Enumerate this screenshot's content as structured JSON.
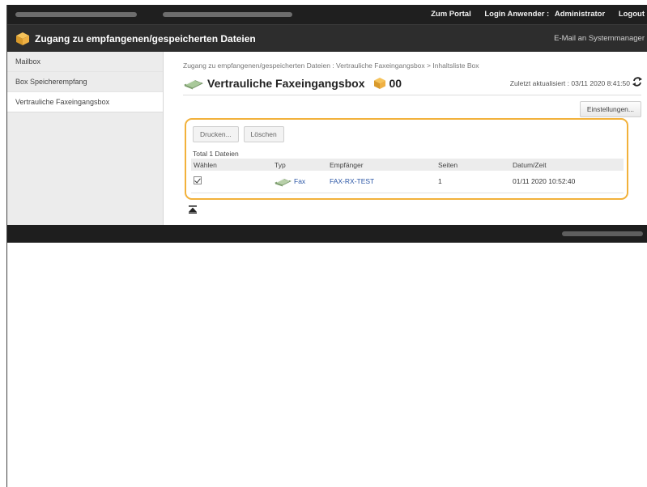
{
  "topbar": {
    "portal": "Zum Portal",
    "login_user_label": "Login Anwender :",
    "login_user_value": "Administrator",
    "logout": "Logout"
  },
  "header": {
    "title": "Zugang zu empfangenen/gespeicherten Dateien",
    "mail_admin": "E-Mail an Systemmanager"
  },
  "sidebar": {
    "items": [
      {
        "label": "Mailbox"
      },
      {
        "label": "Box Speicherempfang"
      },
      {
        "label": "Vertrauliche Faxeingangsbox"
      }
    ]
  },
  "main": {
    "breadcrumb": "Zugang zu empfangenen/gespeicherten Dateien : Vertrauliche Faxeingangsbox > Inhaltsliste Box",
    "title": "Vertrauliche Faxeingangsbox",
    "box_number": "00",
    "last_updated": "Zuletzt aktualisiert : 03/11 2020 8:41:50",
    "settings_button": "Einstellungen...",
    "print_button": "Drucken...",
    "delete_button": "Löschen",
    "total": "Total 1 Dateien",
    "columns": [
      "Wählen",
      "Typ",
      "Empfänger",
      "Seiten",
      "Datum/Zeit"
    ],
    "rows": [
      {
        "selected": true,
        "type": "Fax",
        "recipient": "FAX-RX-TEST",
        "pages": "1",
        "datetime": "01/11 2020 10:52:40"
      }
    ]
  },
  "colors": {
    "accent": "#f2b13a",
    "topbar": "#1f1f1f",
    "titlebar": "#2d2d2d",
    "link": "#2a55a5"
  }
}
